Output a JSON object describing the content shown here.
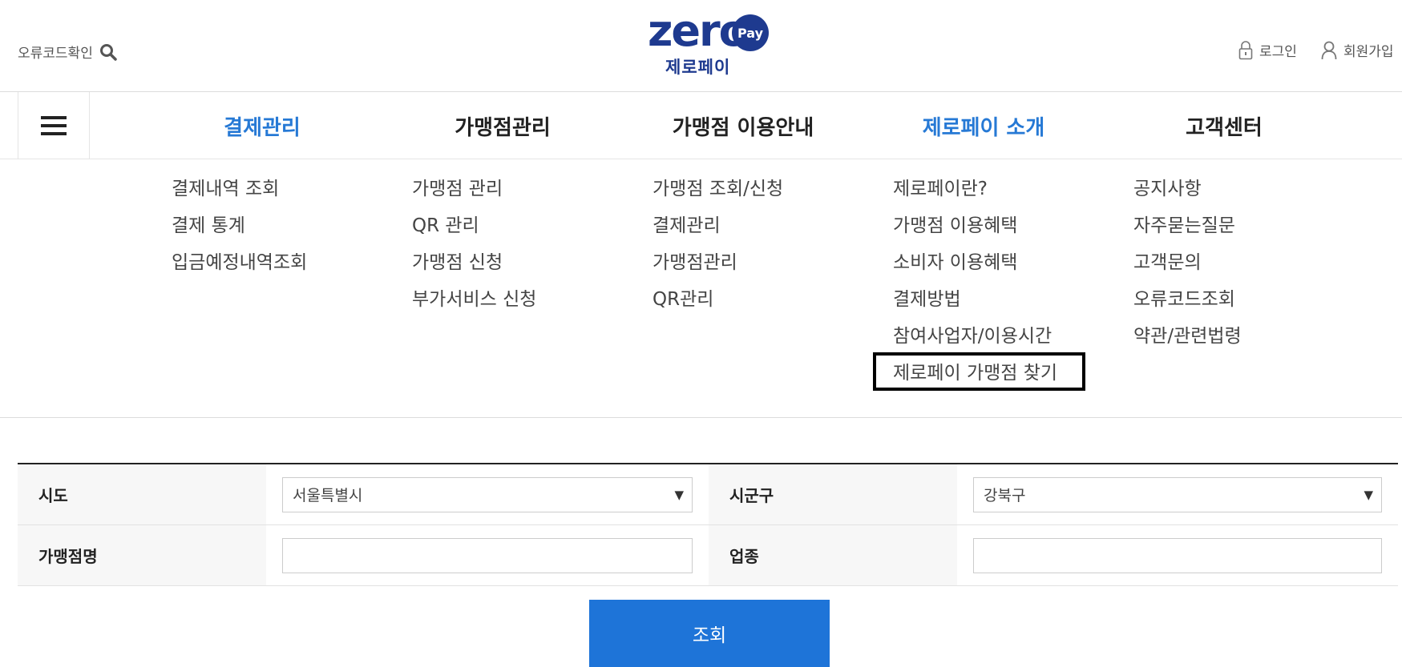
{
  "header": {
    "error_code_link": "오류코드확인",
    "logo_word": "zero",
    "logo_pay": "Pay",
    "logo_sub": "제로페이",
    "login": "로그인",
    "join": "회원가입"
  },
  "nav": {
    "items": [
      {
        "label": "결제관리",
        "active": true
      },
      {
        "label": "가맹점관리",
        "active": false
      },
      {
        "label": "가맹점 이용안내",
        "active": false
      },
      {
        "label": "제로페이 소개",
        "active": true
      },
      {
        "label": "고객센터",
        "active": false
      }
    ],
    "active_color": "#2679d5"
  },
  "menu": {
    "col1": [
      "결제내역 조회",
      "결제 통계",
      "입금예정내역조회"
    ],
    "col2": [
      "가맹점 관리",
      "QR 관리",
      "가맹점 신청",
      "부가서비스 신청"
    ],
    "col3": [
      "가맹점 조회/신청",
      "결제관리",
      "가맹점관리",
      "QR관리"
    ],
    "col4": [
      "제로페이란?",
      "가맹점 이용혜택",
      "소비자 이용혜택",
      "결제방법",
      "참여사업자/이용시간",
      "제로페이 가맹점 찾기"
    ],
    "col5": [
      "공지사항",
      "자주묻는질문",
      "고객문의",
      "오류코드조회",
      "약관/관련법령"
    ]
  },
  "form": {
    "sido_label": "시도",
    "sido_value": "서울특별시",
    "sigungu_label": "시군구",
    "sigungu_value": "강북구",
    "store_name_label": "가맹점명",
    "store_name_value": "",
    "category_label": "업종",
    "category_value": "",
    "search_button": "조회"
  },
  "colors": {
    "brand": "#1e3a8f",
    "button": "#1e74d8"
  },
  "icons": [
    "search-icon",
    "lock-icon",
    "user-icon",
    "hamburger-icon",
    "dropdown-arrow-icon"
  ]
}
